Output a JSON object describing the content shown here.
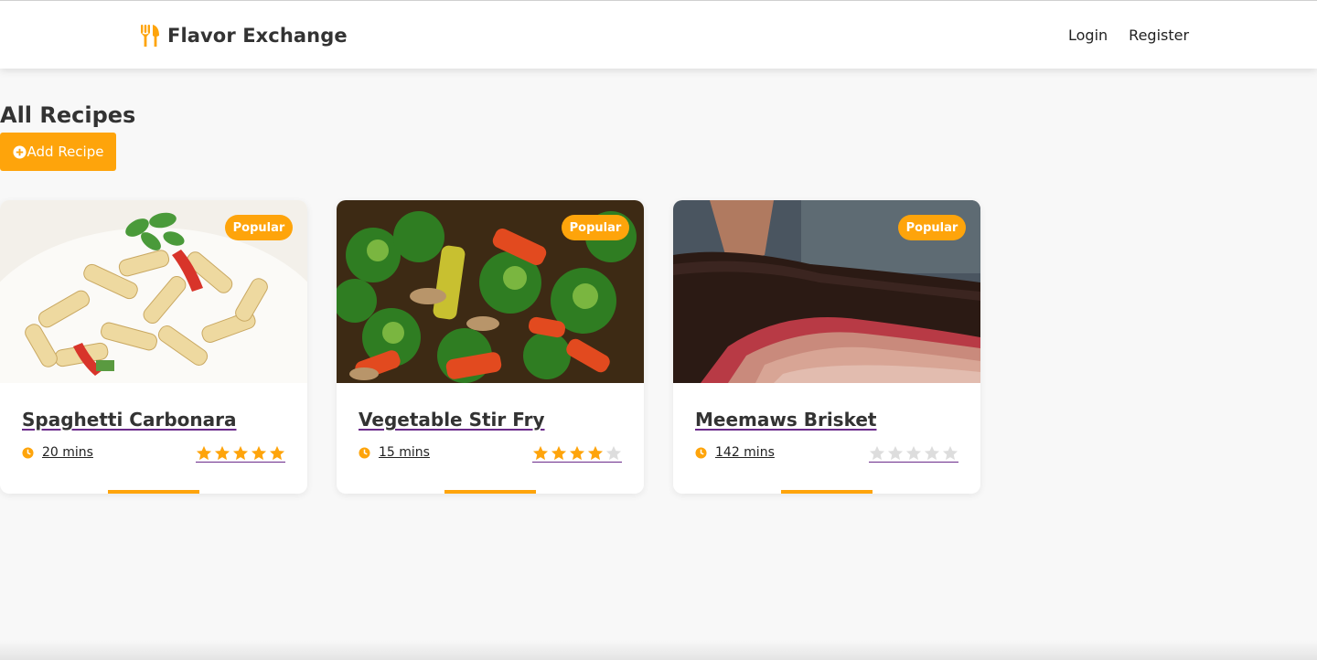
{
  "brand": {
    "name": "Flavor Exchange",
    "icon": "utensils-icon",
    "accent": "#fea40b"
  },
  "nav": {
    "login": "Login",
    "register": "Register"
  },
  "page": {
    "title": "All Recipes",
    "add_button": "Add Recipe",
    "add_icon": "plus-circle-icon"
  },
  "recipes": [
    {
      "title": "Spaghetti Carbonara",
      "time": "20 mins",
      "badge": "Popular",
      "rating": 5,
      "max_rating": 5,
      "image": "pasta-dish-photo"
    },
    {
      "title": "Vegetable Stir Fry",
      "time": "15 mins",
      "badge": "Popular",
      "rating": 4,
      "max_rating": 5,
      "image": "vegetable-stir-fry-photo"
    },
    {
      "title": "Meemaws Brisket",
      "time": "142 mins",
      "badge": "Popular",
      "rating": 0,
      "max_rating": 5,
      "image": "smoked-brisket-photo"
    }
  ],
  "colors": {
    "star_filled": "#fea40b",
    "star_empty": "#dddddd",
    "link_underline": "#6b2a8a"
  }
}
